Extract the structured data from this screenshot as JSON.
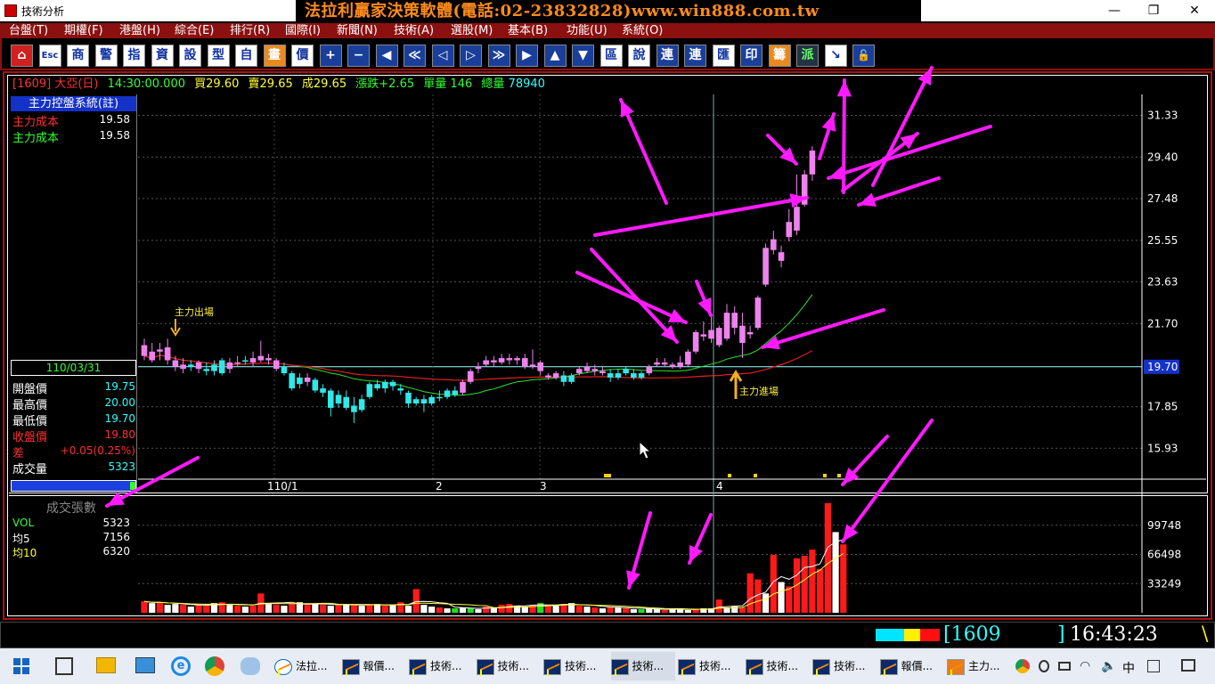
{
  "window": {
    "title": "技術分析",
    "banner": "法拉利贏家決策軟體(電話:02-23832828)www.win888.com.tw",
    "minimize": "—",
    "restore": "❐",
    "close": "✕"
  },
  "menu": [
    "台盤(T)",
    "期權(F)",
    "港盤(H)",
    "綜合(E)",
    "排行(R)",
    "國際(I)",
    "新聞(N)",
    "技術(A)",
    "選股(M)",
    "基本(B)",
    "功能(U)",
    "系統(O)"
  ],
  "toolbar": [
    "⌂",
    "Esc",
    "商",
    "警",
    "指",
    "資",
    "設",
    "型",
    "自",
    "畫",
    "價",
    "+",
    "−",
    "◀",
    "≪",
    "◁",
    "▷",
    "≫",
    "▶",
    "▲",
    "▼",
    "區",
    "說",
    "連",
    "連",
    "匯",
    "印",
    "籌",
    "派",
    "↘",
    "🔓"
  ],
  "quote": {
    "symbol": "[1609] 大亞(日)",
    "time": "14:30:00.000",
    "bid_label": "買",
    "bid": "29.60",
    "ask_label": "賣",
    "ask": "29.65",
    "last_label": "成",
    "last": "29.65",
    "chg_label": "漲跌",
    "chg": "+2.65",
    "vol_label": "單量",
    "vol": "146",
    "total_label": "總量",
    "total": "78940"
  },
  "left_panel": {
    "header": "主力控盤系統(註)",
    "rows": [
      {
        "label": "主力成本",
        "value": "19.58",
        "color": "#ff3030"
      },
      {
        "label": "主力成本",
        "value": "19.58",
        "color": "#30ff30"
      }
    ],
    "date": "110/03/31",
    "ohlc": [
      {
        "label": "開盤價",
        "value": "19.75",
        "lc": "#ffffff",
        "vc": "#30ffff"
      },
      {
        "label": "最高價",
        "value": "20.00",
        "lc": "#ffffff",
        "vc": "#30ffff"
      },
      {
        "label": "最低價",
        "value": "19.70",
        "lc": "#ffffff",
        "vc": "#30ffff"
      },
      {
        "label": "收盤價",
        "value": "19.80",
        "lc": "#ff3030",
        "vc": "#ff3030"
      },
      {
        "label": "差",
        "value": "+0.05(0.25%)",
        "lc": "#ff3030",
        "vc": "#ff3030"
      },
      {
        "label": "成交量",
        "value": "5323",
        "lc": "#ffffff",
        "vc": "#30ffff"
      }
    ]
  },
  "volume_panel": {
    "title": "成交張數",
    "rows": [
      {
        "label": "VOL",
        "value": "5323",
        "color": "#30ff30"
      },
      {
        "label": "均5",
        "value": "7156",
        "color": "#ffffff"
      },
      {
        "label": "均10",
        "value": "6320",
        "color": "#ffff30"
      }
    ]
  },
  "annotations": {
    "exit": "主力出場",
    "entry": "主力進場"
  },
  "price_axis": {
    "labels": [
      "31.33",
      "29.40",
      "27.48",
      "25.55",
      "23.63",
      "21.70",
      "19.70",
      "17.85",
      "15.93"
    ],
    "current": "19.70"
  },
  "volume_axis": {
    "labels": [
      "99748",
      "66498",
      "33249"
    ]
  },
  "x_axis": {
    "labels": [
      "110/1",
      "2",
      "3",
      "4"
    ]
  },
  "status": {
    "code": "[1609",
    "bracket": "]",
    "clock": "16:43:23",
    "tail": "\\"
  },
  "taskbar": [
    {
      "label": "法拉...",
      "active": false
    },
    {
      "label": "報價...",
      "active": false
    },
    {
      "label": "技術...",
      "active": false
    },
    {
      "label": "技術...",
      "active": false
    },
    {
      "label": "技術...",
      "active": false
    },
    {
      "label": "技術...",
      "active": true
    },
    {
      "label": "技術...",
      "active": false
    },
    {
      "label": "技術...",
      "active": false
    },
    {
      "label": "技術...",
      "active": false
    },
    {
      "label": "報價...",
      "active": false
    },
    {
      "label": "主力...",
      "active": false
    }
  ],
  "tray": {
    "ime": "中"
  },
  "chart_data": {
    "type": "candlestick",
    "price_ylim": [
      14.5,
      32.3
    ],
    "volume_ylim": [
      0,
      130000
    ],
    "candles": [
      [
        20.7,
        20.2,
        21.0,
        20.0,
        "k"
      ],
      [
        20.4,
        20.0,
        20.8,
        19.9,
        "k"
      ],
      [
        20.4,
        20.5,
        20.8,
        20.0,
        "k"
      ],
      [
        20.6,
        20.0,
        21.0,
        19.8,
        "k"
      ],
      [
        20.0,
        19.7,
        20.2,
        19.5,
        "k"
      ],
      [
        19.8,
        19.6,
        20.1,
        19.4,
        "k"
      ],
      [
        19.7,
        19.8,
        20.0,
        19.5,
        "c"
      ],
      [
        19.9,
        19.6,
        20.0,
        19.4,
        "k"
      ],
      [
        19.6,
        19.5,
        19.9,
        19.3,
        "c"
      ],
      [
        19.8,
        19.5,
        20.0,
        19.3,
        "c"
      ],
      [
        20.0,
        19.4,
        20.1,
        19.3,
        "c"
      ],
      [
        19.6,
        19.9,
        20.1,
        19.4,
        "k"
      ],
      [
        19.9,
        19.9,
        20.2,
        19.7,
        "k"
      ],
      [
        20.0,
        20.0,
        20.2,
        19.8,
        "c"
      ],
      [
        19.9,
        20.1,
        20.4,
        19.7,
        "k"
      ],
      [
        20.2,
        20.0,
        20.9,
        19.9,
        "k"
      ],
      [
        20.1,
        20.0,
        20.3,
        19.8,
        "k"
      ],
      [
        20.0,
        19.6,
        20.1,
        19.5,
        "k"
      ],
      [
        19.7,
        19.4,
        19.9,
        19.3,
        "c"
      ],
      [
        19.4,
        18.7,
        19.5,
        18.6,
        "c"
      ],
      [
        18.9,
        19.2,
        19.4,
        18.7,
        "c"
      ],
      [
        19.2,
        19.0,
        19.4,
        18.8,
        "k"
      ],
      [
        19.1,
        18.6,
        19.2,
        18.5,
        "c"
      ],
      [
        18.7,
        18.5,
        18.9,
        18.3,
        "c"
      ],
      [
        18.6,
        17.8,
        18.7,
        17.4,
        "c"
      ],
      [
        18.0,
        18.4,
        18.6,
        17.8,
        "c"
      ],
      [
        18.3,
        17.8,
        18.6,
        17.7,
        "c"
      ],
      [
        17.9,
        17.6,
        18.3,
        17.1,
        "c"
      ],
      [
        17.7,
        18.2,
        18.4,
        17.6,
        "c"
      ],
      [
        18.3,
        18.9,
        19.0,
        18.2,
        "c"
      ],
      [
        18.9,
        18.7,
        19.1,
        18.6,
        "c"
      ],
      [
        18.7,
        19.0,
        19.1,
        18.5,
        "c"
      ],
      [
        19.0,
        18.8,
        19.1,
        18.6,
        "c"
      ],
      [
        18.7,
        18.6,
        18.9,
        18.4,
        "c"
      ],
      [
        18.5,
        18.0,
        18.6,
        17.8,
        "c"
      ],
      [
        18.0,
        18.2,
        18.3,
        17.9,
        "c"
      ],
      [
        18.2,
        18.0,
        18.4,
        17.6,
        "c"
      ],
      [
        18.0,
        18.3,
        18.4,
        17.9,
        "c"
      ],
      [
        18.3,
        18.3,
        18.6,
        18.1,
        "c"
      ],
      [
        18.3,
        18.6,
        18.7,
        18.2,
        "c"
      ],
      [
        18.6,
        18.4,
        18.8,
        18.3,
        "c"
      ],
      [
        18.5,
        19.0,
        19.1,
        18.4,
        "k"
      ],
      [
        19.0,
        19.5,
        19.6,
        18.9,
        "k"
      ],
      [
        19.6,
        19.7,
        19.9,
        19.4,
        "k"
      ],
      [
        19.8,
        20.0,
        20.2,
        19.7,
        "k"
      ],
      [
        20.0,
        19.9,
        20.2,
        19.7,
        "k"
      ],
      [
        19.9,
        20.1,
        20.3,
        19.8,
        "k"
      ],
      [
        20.1,
        20.0,
        20.3,
        19.8,
        "k"
      ],
      [
        20.0,
        20.1,
        20.2,
        19.8,
        "k"
      ],
      [
        20.1,
        19.7,
        20.3,
        19.6,
        "k"
      ],
      [
        19.7,
        19.8,
        20.5,
        19.6,
        "k"
      ],
      [
        19.9,
        19.5,
        20.0,
        19.3,
        "k"
      ],
      [
        19.3,
        19.2,
        19.4,
        19.1,
        "k"
      ],
      [
        19.2,
        19.4,
        19.5,
        19.1,
        "k"
      ],
      [
        19.3,
        19.0,
        19.5,
        18.8,
        "c"
      ],
      [
        19.0,
        19.3,
        19.4,
        18.9,
        "c"
      ],
      [
        19.4,
        19.6,
        19.7,
        19.3,
        "k"
      ],
      [
        19.7,
        19.5,
        19.9,
        19.4,
        "k"
      ],
      [
        19.6,
        19.5,
        19.8,
        19.3,
        "k"
      ],
      [
        19.5,
        19.4,
        19.7,
        19.3,
        "k"
      ],
      [
        19.4,
        19.2,
        19.6,
        19.0,
        "c"
      ],
      [
        19.2,
        19.4,
        19.6,
        19.1,
        "c"
      ],
      [
        19.4,
        19.6,
        19.7,
        19.3,
        "c"
      ],
      [
        19.4,
        19.2,
        19.6,
        19.1,
        "c"
      ],
      [
        19.2,
        19.4,
        19.5,
        19.1,
        "c"
      ],
      [
        19.4,
        19.7,
        19.8,
        19.3,
        "k"
      ],
      [
        19.8,
        19.9,
        20.1,
        19.7,
        "k"
      ],
      [
        19.8,
        19.9,
        20.1,
        19.7,
        "k"
      ],
      [
        19.7,
        19.8,
        19.9,
        19.6,
        "k"
      ],
      [
        19.7,
        19.9,
        20.2,
        19.6,
        "k"
      ],
      [
        19.8,
        20.4,
        20.5,
        19.7,
        "k"
      ],
      [
        20.4,
        21.3,
        21.4,
        20.3,
        "k"
      ],
      [
        21.2,
        21.1,
        21.8,
        20.9,
        "k"
      ],
      [
        21.0,
        21.4,
        22.0,
        20.8,
        "k"
      ],
      [
        21.5,
        20.7,
        21.6,
        20.6,
        "k"
      ],
      [
        21.0,
        22.2,
        22.6,
        20.9,
        "k"
      ],
      [
        22.2,
        21.5,
        22.5,
        21.2,
        "k"
      ],
      [
        21.6,
        20.8,
        22.2,
        20.1,
        "k"
      ],
      [
        21.2,
        21.3,
        21.6,
        21.0,
        "k"
      ],
      [
        21.5,
        22.9,
        23.0,
        21.4,
        "k"
      ],
      [
        23.5,
        25.2,
        25.4,
        23.4,
        "k"
      ],
      [
        25.1,
        25.6,
        26.0,
        24.9,
        "k"
      ],
      [
        24.6,
        25.0,
        25.3,
        24.3,
        "k"
      ],
      [
        25.7,
        26.4,
        27.0,
        25.5,
        "k"
      ],
      [
        26.0,
        27.1,
        28.6,
        25.8,
        "k"
      ],
      [
        27.2,
        28.6,
        28.8,
        27.1,
        "k"
      ],
      [
        28.6,
        29.7,
        29.9,
        28.3,
        "k"
      ]
    ],
    "volume": [
      [
        13000,
        "r"
      ],
      [
        11000,
        "w"
      ],
      [
        12000,
        "r"
      ],
      [
        9000,
        "w"
      ],
      [
        10000,
        "w"
      ],
      [
        9000,
        "r"
      ],
      [
        7000,
        "w"
      ],
      [
        9000,
        "r"
      ],
      [
        8000,
        "r"
      ],
      [
        11000,
        "w"
      ],
      [
        12000,
        "r"
      ],
      [
        9000,
        "w"
      ],
      [
        8000,
        "r"
      ],
      [
        7000,
        "w"
      ],
      [
        8000,
        "r"
      ],
      [
        22000,
        "r"
      ],
      [
        10000,
        "w"
      ],
      [
        9000,
        "r"
      ],
      [
        8000,
        "w"
      ],
      [
        11000,
        "r"
      ],
      [
        12000,
        "w"
      ],
      [
        9000,
        "r"
      ],
      [
        10000,
        "w"
      ],
      [
        9000,
        "r"
      ],
      [
        8000,
        "w"
      ],
      [
        10000,
        "r"
      ],
      [
        9000,
        "w"
      ],
      [
        9000,
        "r"
      ],
      [
        8000,
        "w"
      ],
      [
        9000,
        "r"
      ],
      [
        10000,
        "w"
      ],
      [
        8000,
        "r"
      ],
      [
        9000,
        "w"
      ],
      [
        12000,
        "r"
      ],
      [
        8000,
        "w"
      ],
      [
        27000,
        "r"
      ],
      [
        9000,
        "w"
      ],
      [
        7000,
        "w"
      ],
      [
        6000,
        "r"
      ],
      [
        5000,
        "w"
      ],
      [
        5000,
        "g"
      ],
      [
        6000,
        "w"
      ],
      [
        5000,
        "g"
      ],
      [
        4000,
        "w"
      ],
      [
        7000,
        "r"
      ],
      [
        5000,
        "w"
      ],
      [
        9000,
        "r"
      ],
      [
        10000,
        "r"
      ],
      [
        8000,
        "w"
      ],
      [
        7000,
        "w"
      ],
      [
        9000,
        "r"
      ],
      [
        11000,
        "g"
      ],
      [
        9000,
        "r"
      ],
      [
        8000,
        "w"
      ],
      [
        10000,
        "r"
      ],
      [
        11000,
        "w"
      ],
      [
        8000,
        "r"
      ],
      [
        7000,
        "w"
      ],
      [
        6000,
        "r"
      ],
      [
        5000,
        "w"
      ],
      [
        7000,
        "r"
      ],
      [
        6000,
        "w"
      ],
      [
        5000,
        "r"
      ],
      [
        4000,
        "w"
      ],
      [
        4000,
        "g"
      ],
      [
        5000,
        "w"
      ],
      [
        4000,
        "w"
      ],
      [
        3000,
        "r"
      ],
      [
        4000,
        "w"
      ],
      [
        5000,
        "w"
      ],
      [
        3000,
        "w"
      ],
      [
        4000,
        "r"
      ],
      [
        5000,
        "w"
      ],
      [
        5000,
        "w"
      ],
      [
        15000,
        "r"
      ],
      [
        6000,
        "w"
      ],
      [
        7000,
        "w"
      ],
      [
        6000,
        "r"
      ],
      [
        45000,
        "r"
      ],
      [
        38000,
        "r"
      ],
      [
        22000,
        "w"
      ],
      [
        66000,
        "r"
      ],
      [
        35000,
        "w"
      ],
      [
        30000,
        "r"
      ],
      [
        62000,
        "r"
      ],
      [
        65000,
        "r"
      ],
      [
        72000,
        "r"
      ],
      [
        50000,
        "r"
      ],
      [
        125000,
        "r"
      ],
      [
        92000,
        "w"
      ],
      [
        78000,
        "r"
      ]
    ]
  }
}
